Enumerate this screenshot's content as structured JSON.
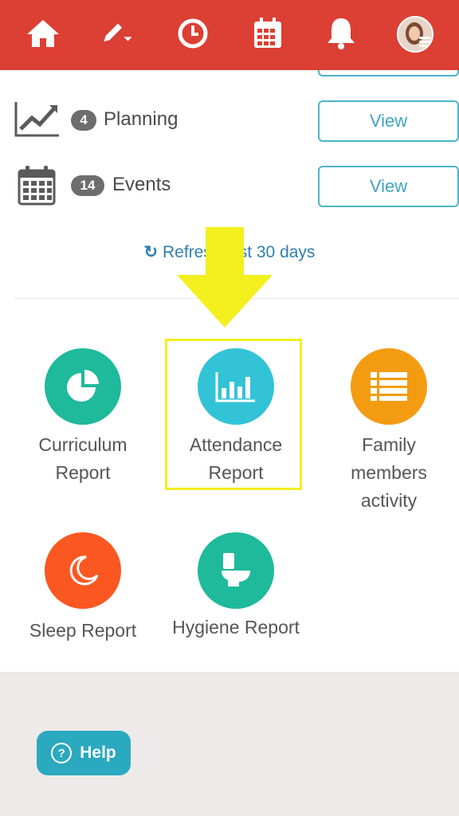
{
  "nav": {
    "icons": [
      "home-icon",
      "edit-icon",
      "clock-icon",
      "calendar-icon",
      "bell-icon",
      "avatar"
    ],
    "bar_color": "#dc3f33"
  },
  "rows": [
    {
      "count": "4",
      "label": "Planning",
      "button": "View"
    },
    {
      "count": "14",
      "label": "Events",
      "button": "View"
    }
  ],
  "refresh_text": "Refresh last 30 days",
  "reports": [
    {
      "line1": "Curriculum",
      "line2": "Report",
      "line3": "",
      "color": "#1fb99b"
    },
    {
      "line1": "Attendance",
      "line2": "Report",
      "line3": "",
      "color": "#32c3d6"
    },
    {
      "line1": "Family",
      "line2": "members",
      "line3": "activity",
      "color": "#f39c12"
    },
    {
      "line1": "Sleep Report",
      "line2": "",
      "line3": "",
      "color": "#fb5721"
    },
    {
      "line1": "Hygiene Report",
      "line2": "",
      "line3": "",
      "color": "#1fb99b"
    }
  ],
  "help": {
    "label": "Help"
  },
  "annotation": {
    "arrow_color": "#f4ef1f",
    "box_color": "#f4ef1f"
  }
}
